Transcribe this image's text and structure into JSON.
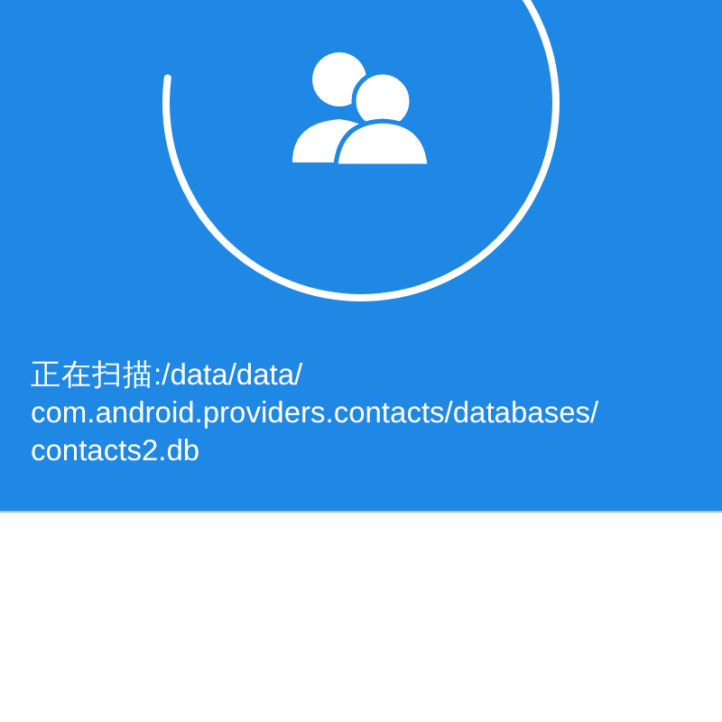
{
  "scan": {
    "status": "正在扫描:/data/data/com.android.providers.contacts/databases/contacts2.db"
  }
}
